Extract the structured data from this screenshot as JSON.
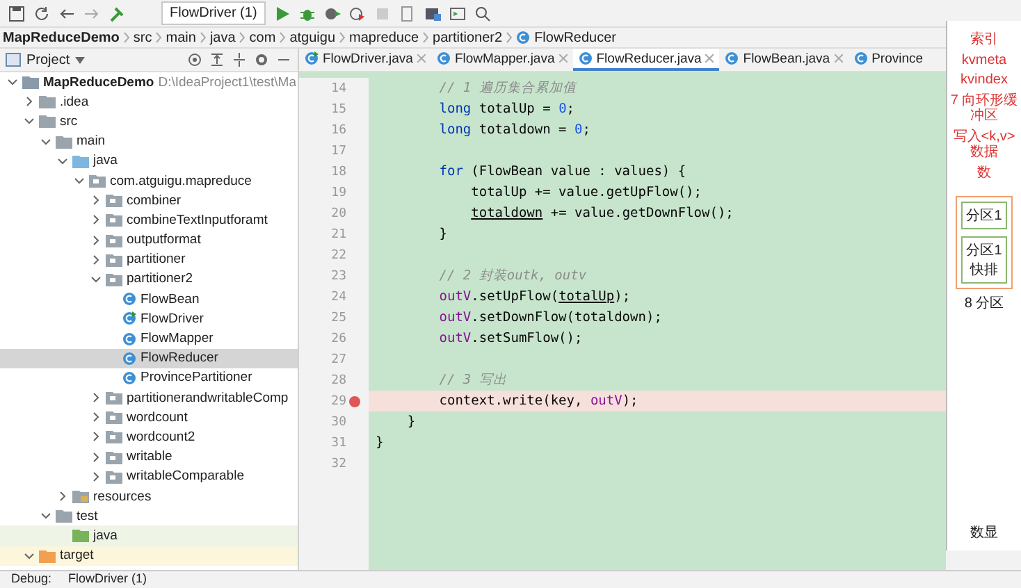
{
  "toolbar": {
    "run_config": "FlowDriver (1)"
  },
  "breadcrumb": [
    "MapReduceDemo",
    "src",
    "main",
    "java",
    "com",
    "atguigu",
    "mapreduce",
    "partitioner2",
    "FlowReducer"
  ],
  "project_panel": {
    "title": "Project",
    "tree": [
      {
        "label": "MapReduceDemo",
        "path": "D:\\IdeaProject1\\test\\Ma",
        "kind": "module",
        "expanded": true,
        "selected": false,
        "children": [
          {
            "label": ".idea",
            "kind": "folder",
            "expanded": false,
            "selected": false
          },
          {
            "label": "src",
            "kind": "folder",
            "expanded": true,
            "selected": false,
            "children": [
              {
                "label": "main",
                "kind": "folder",
                "expanded": true,
                "selected": false,
                "children": [
                  {
                    "label": "java",
                    "kind": "source",
                    "expanded": true,
                    "selected": false,
                    "children": [
                      {
                        "label": "com.atguigu.mapreduce",
                        "kind": "package",
                        "expanded": true,
                        "selected": false,
                        "children": [
                          {
                            "label": "combiner",
                            "kind": "package",
                            "expanded": false,
                            "selected": false
                          },
                          {
                            "label": "combineTextInputforamt",
                            "kind": "package",
                            "expanded": false,
                            "selected": false
                          },
                          {
                            "label": "outputformat",
                            "kind": "package",
                            "expanded": false,
                            "selected": false
                          },
                          {
                            "label": "partitioner",
                            "kind": "package",
                            "expanded": false,
                            "selected": false
                          },
                          {
                            "label": "partitioner2",
                            "kind": "package",
                            "expanded": true,
                            "selected": false,
                            "children": [
                              {
                                "label": "FlowBean",
                                "kind": "class",
                                "selected": false
                              },
                              {
                                "label": "FlowDriver",
                                "kind": "main-class",
                                "selected": false
                              },
                              {
                                "label": "FlowMapper",
                                "kind": "class",
                                "selected": false
                              },
                              {
                                "label": "FlowReducer",
                                "kind": "class",
                                "selected": true
                              },
                              {
                                "label": "ProvincePartitioner",
                                "kind": "class",
                                "selected": false
                              }
                            ]
                          },
                          {
                            "label": "partitionerandwritableComp",
                            "kind": "package",
                            "expanded": false,
                            "selected": false
                          },
                          {
                            "label": "wordcount",
                            "kind": "package",
                            "expanded": false,
                            "selected": false
                          },
                          {
                            "label": "wordcount2",
                            "kind": "package",
                            "expanded": false,
                            "selected": false
                          },
                          {
                            "label": "writable",
                            "kind": "package",
                            "expanded": false,
                            "selected": false
                          },
                          {
                            "label": "writableComparable",
                            "kind": "package",
                            "expanded": false,
                            "selected": false
                          }
                        ]
                      }
                    ]
                  },
                  {
                    "label": "resources",
                    "kind": "resources",
                    "expanded": false,
                    "selected": false
                  }
                ]
              },
              {
                "label": "test",
                "kind": "folder",
                "expanded": true,
                "selected": false,
                "children": [
                  {
                    "label": "java",
                    "kind": "test-source",
                    "selected": false
                  }
                ]
              }
            ]
          },
          {
            "label": "target",
            "kind": "excluded",
            "expanded": true,
            "selected": false
          }
        ]
      }
    ]
  },
  "tabs": [
    {
      "label": "FlowDriver.java",
      "kind": "main-class",
      "selected": false,
      "closable": true
    },
    {
      "label": "FlowMapper.java",
      "kind": "class",
      "selected": false,
      "closable": true
    },
    {
      "label": "FlowReducer.java",
      "kind": "class",
      "selected": true,
      "closable": true
    },
    {
      "label": "FlowBean.java",
      "kind": "class",
      "selected": false,
      "closable": true
    },
    {
      "label": "Province",
      "kind": "class",
      "selected": false,
      "closable": false
    }
  ],
  "code": [
    {
      "number": "14",
      "tokens": [
        {
          "kind": "comment",
          "text": "        // 1 遍历集合累加值"
        }
      ]
    },
    {
      "number": "15",
      "tokens": [
        {
          "kind": "keyword",
          "text": "        long"
        },
        {
          "kind": "plain",
          "text": " totalUp = "
        },
        {
          "kind": "number",
          "text": "0"
        },
        {
          "kind": "plain",
          "text": ";"
        }
      ]
    },
    {
      "number": "16",
      "tokens": [
        {
          "kind": "keyword",
          "text": "        long"
        },
        {
          "kind": "plain",
          "text": " totaldown = "
        },
        {
          "kind": "number",
          "text": "0"
        },
        {
          "kind": "plain",
          "text": ";"
        }
      ]
    },
    {
      "number": "17"
    },
    {
      "number": "18",
      "tokens": [
        {
          "kind": "keyword",
          "text": "        for"
        },
        {
          "kind": "plain",
          "text": " (FlowBean value : values) {"
        }
      ]
    },
    {
      "number": "19",
      "tokens": [
        {
          "kind": "plain",
          "text": "            totalUp += value.getUpFlow();"
        }
      ]
    },
    {
      "number": "20",
      "tokens": [
        {
          "kind": "underlined",
          "text": "            totaldown"
        },
        {
          "kind": "plain",
          "text": " += value.getDownFlow();"
        }
      ]
    },
    {
      "number": "21",
      "tokens": [
        {
          "kind": "plain",
          "text": "        }"
        }
      ]
    },
    {
      "number": "22"
    },
    {
      "number": "23",
      "tokens": [
        {
          "kind": "comment",
          "text": "        // 2 封装outk, outv"
        }
      ]
    },
    {
      "number": "24",
      "tokens": [
        {
          "kind": "field",
          "text": "        outV"
        },
        {
          "kind": "plain",
          "text": ".setUpFlow("
        },
        {
          "kind": "underlined",
          "text": "totalUp"
        },
        {
          "kind": "plain",
          "text": ");"
        }
      ]
    },
    {
      "number": "25",
      "tokens": [
        {
          "kind": "field",
          "text": "        outV"
        },
        {
          "kind": "plain",
          "text": ".setDownFlow(totaldown);"
        }
      ]
    },
    {
      "number": "26",
      "tokens": [
        {
          "kind": "field",
          "text": "        outV"
        },
        {
          "kind": "plain",
          "text": ".setSumFlow();"
        }
      ]
    },
    {
      "number": "27"
    },
    {
      "number": "28",
      "tokens": [
        {
          "kind": "comment",
          "text": "        // 3 写出"
        }
      ]
    },
    {
      "number": "29",
      "breakpoint": true,
      "tokens": [
        {
          "kind": "plain",
          "text": "        context.write(key, "
        },
        {
          "kind": "field",
          "text": "outV"
        },
        {
          "kind": "plain",
          "text": ");"
        }
      ]
    },
    {
      "number": "30",
      "tokens": [
        {
          "kind": "plain",
          "text": "    }"
        }
      ]
    },
    {
      "number": "31",
      "tokens": [
        {
          "kind": "plain",
          "text": "}"
        }
      ]
    },
    {
      "number": "32"
    }
  ],
  "overlay_window": {
    "labels": [
      {
        "text": "索引",
        "kind": "red"
      },
      {
        "text": "kvmeta",
        "kind": "red"
      },
      {
        "text": "kvindex",
        "kind": "red"
      },
      {
        "text": "7 向环形缓冲区",
        "kind": "red"
      },
      {
        "text": "写入<k,v>数据",
        "kind": "red"
      },
      {
        "text": "数",
        "kind": "red"
      }
    ],
    "partition_boxes": [
      "分区1",
      "分区1\n快排"
    ],
    "caption": "8 分区",
    "footer": "数显"
  },
  "bottom_bar": {
    "label": "Debug:",
    "config": "FlowDriver (1)"
  }
}
